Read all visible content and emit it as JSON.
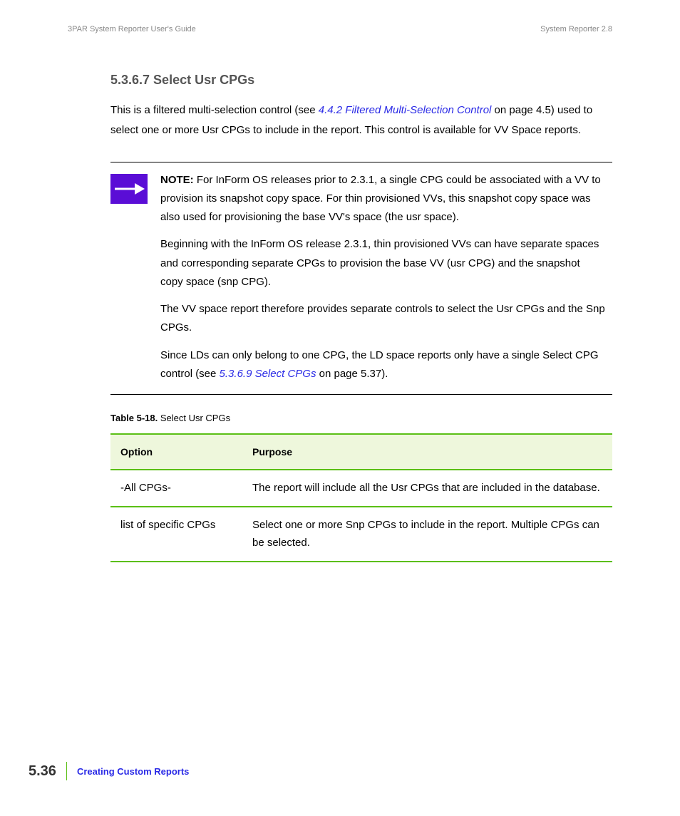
{
  "header": {
    "left": "3PAR System Reporter User's Guide",
    "right": "System Reporter 2.8"
  },
  "heading": "5.3.6.7 Select Usr CPGs",
  "intro": {
    "pre": "This is a filtered multi-selection control (see ",
    "link": "4.4.2 Filtered Multi-Selection Control",
    "post": " on page 4.5) used to select one or more Usr CPGs to include in the report. This control is available for VV Space reports."
  },
  "note": {
    "label": "NOTE:",
    "p1_rest": " For InForm OS releases prior to 2.3.1, a single CPG could be associated with a VV to provision its snapshot copy space. For thin provisioned VVs, this snapshot copy space was also used for provisioning the base VV's space (the usr space).",
    "p2": "Beginning with the InForm OS release 2.3.1, thin provisioned VVs can have separate spaces and corresponding separate CPGs to provision the base VV (usr CPG) and the snapshot copy space (snp CPG).",
    "p3": "The VV space report therefore provides separate controls to select the Usr CPGs and the Snp CPGs.",
    "p4_pre": "Since LDs can only belong to one CPG, the LD space reports only have a single Select CPG control (see ",
    "p4_link": "5.3.6.9 Select CPGs",
    "p4_post": " on page 5.37)."
  },
  "table_caption": {
    "bold": "Table 5-18.",
    "rest": "  Select Usr CPGs"
  },
  "table": {
    "headers": [
      "Option",
      "Purpose"
    ],
    "rows": [
      [
        "-All CPGs-",
        "The report will include all the Usr CPGs that are included in the database."
      ],
      [
        "list of specific CPGs",
        "Select one or more Snp CPGs to include in the report. Multiple CPGs can be selected."
      ]
    ]
  },
  "footer": {
    "page": "5.36",
    "title": "Creating Custom Reports"
  }
}
